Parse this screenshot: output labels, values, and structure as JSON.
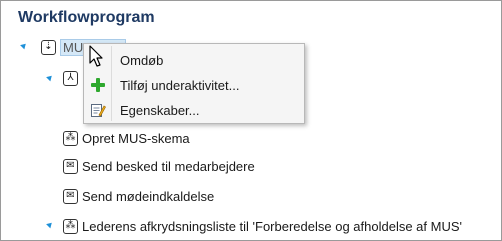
{
  "page_title": "Workflowprogram",
  "tree": {
    "root": {
      "label": "MUS 2011",
      "icon": "sequence-icon",
      "glyph": "⇣"
    },
    "child": {
      "icon": "parallel-icon",
      "glyph": "⅄"
    },
    "items": [
      {
        "label": "Opret MUS-skema",
        "icon": "activity-icon",
        "glyph": "⁂"
      },
      {
        "label": "Send besked til medarbejdere",
        "icon": "mail-icon",
        "glyph": "✉"
      },
      {
        "label": "Send mødeindkaldelse",
        "icon": "mail-icon",
        "glyph": "✉"
      },
      {
        "label": "Lederens afkrydsningsliste til 'Forberedelse og afholdelse af MUS'",
        "icon": "activity-icon",
        "glyph": "⁂"
      }
    ]
  },
  "context_menu": {
    "items": [
      {
        "label": "Omdøb",
        "icon": ""
      },
      {
        "label": "Tilføj underaktivitet...",
        "icon": "add-icon"
      },
      {
        "label": "Egenskaber...",
        "icon": "properties-icon"
      }
    ]
  },
  "colors": {
    "title": "#1f3a63",
    "expander": "#1e90d8",
    "add_icon": "#2ea82e",
    "selection": "#d5e8f7"
  }
}
